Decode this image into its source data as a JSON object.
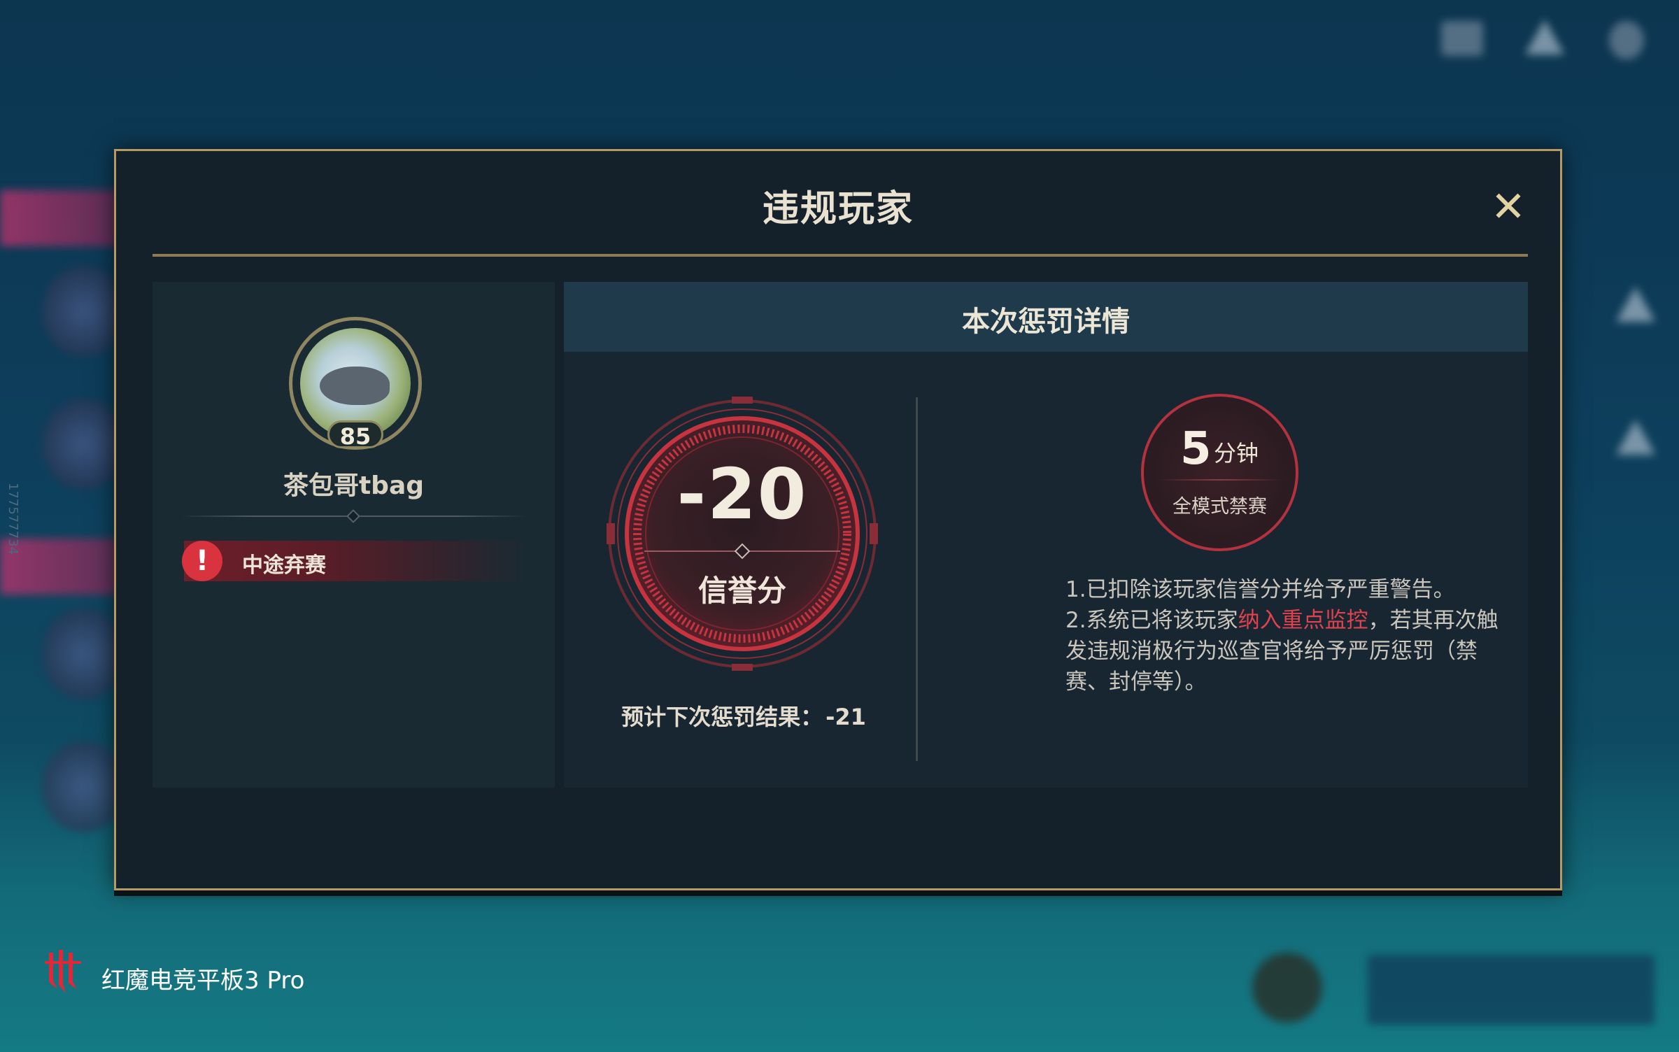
{
  "dialog": {
    "title": "违规玩家",
    "close_icon": "close-icon"
  },
  "player": {
    "level": "85",
    "name": "茶包哥tbag",
    "violation_icon": "exclamation-icon",
    "violation": "中途弃赛"
  },
  "penalty": {
    "header": "本次惩罚详情",
    "score_change": "-20",
    "score_label": "信誉分",
    "next_prefix": "预计下次惩罚结果：",
    "next_value": "-21",
    "ban_number": "5",
    "ban_unit": "分钟",
    "ban_scope": "全模式禁赛",
    "desc_line1": "1.已扣除该玩家信誉分并给予严重警告。",
    "desc_line2_pre": "2.系统已将该玩家",
    "desc_line2_highlight": "纳入重点监控",
    "desc_line2_post": "，若其再次触发违规消极行为巡查官将给予严厉惩罚（禁赛、封停等）。"
  },
  "watermark": {
    "brand": "红魔电竞平板3 Pro",
    "side_code": "177577734"
  },
  "colors": {
    "accent_gold": "#b59a64",
    "penalty_red": "#d8333f",
    "highlight_red": "#e2424f",
    "panel_bg": "#15212a"
  }
}
